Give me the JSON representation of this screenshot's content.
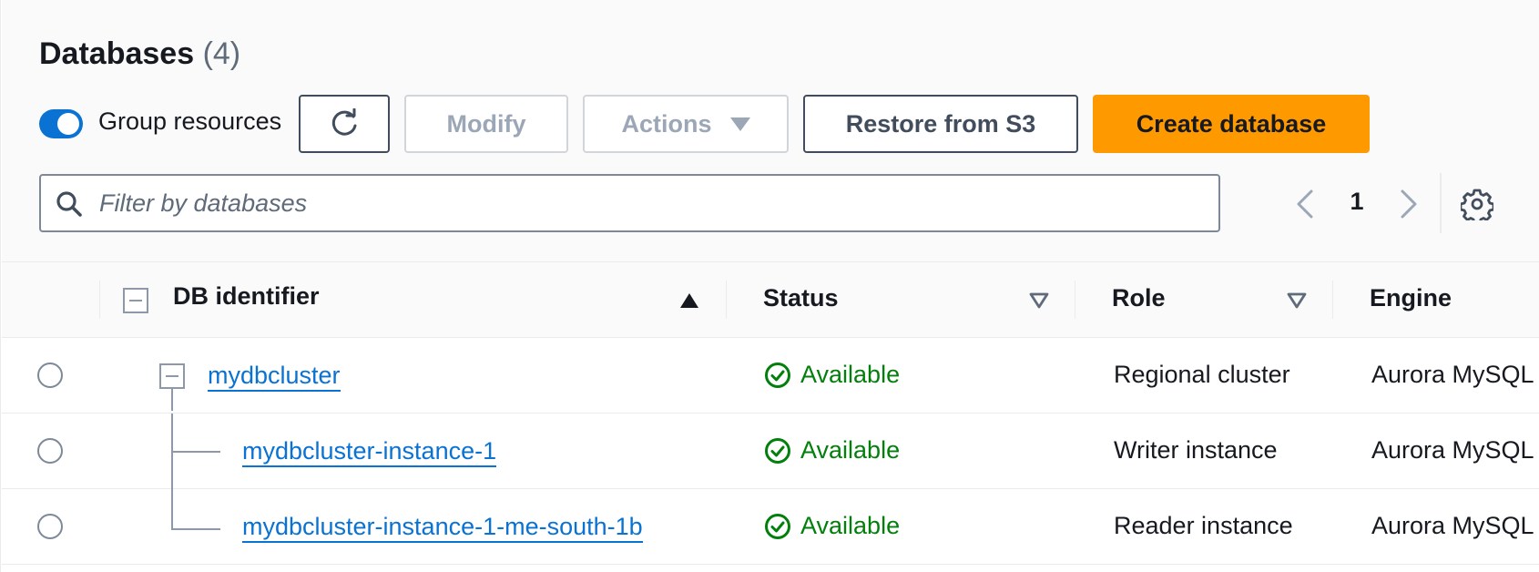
{
  "header": {
    "title": "Databases",
    "count": "(4)"
  },
  "toolbar": {
    "group_resources_label": "Group resources",
    "group_resources_on": true,
    "modify_label": "Modify",
    "actions_label": "Actions",
    "restore_label": "Restore from S3",
    "create_label": "Create database",
    "primary_color": "#ff9900",
    "toggle_color": "#0972d3"
  },
  "search": {
    "placeholder": "Filter by databases",
    "value": ""
  },
  "pagination": {
    "current_page": "1"
  },
  "table": {
    "columns": {
      "db_identifier": "DB identifier",
      "status": "Status",
      "role": "Role",
      "engine": "Engine"
    },
    "rows": [
      {
        "identifier": "mydbcluster",
        "status": "Available",
        "role": "Regional cluster",
        "engine": "Aurora MySQL"
      },
      {
        "identifier": "mydbcluster-instance-1",
        "status": "Available",
        "role": "Writer instance",
        "engine": "Aurora MySQL"
      },
      {
        "identifier": "mydbcluster-instance-1-me-south-1b",
        "status": "Available",
        "role": "Reader instance",
        "engine": "Aurora MySQL"
      }
    ],
    "status_color": "#037f0c",
    "link_color": "#0972d3"
  },
  "icons": [
    "refresh-icon",
    "caret-down-icon",
    "search-icon",
    "chevron-left-icon",
    "chevron-right-icon",
    "gear-icon",
    "sort-ascending-icon",
    "sort-icon",
    "check-circle-icon",
    "collapse-icon"
  ]
}
